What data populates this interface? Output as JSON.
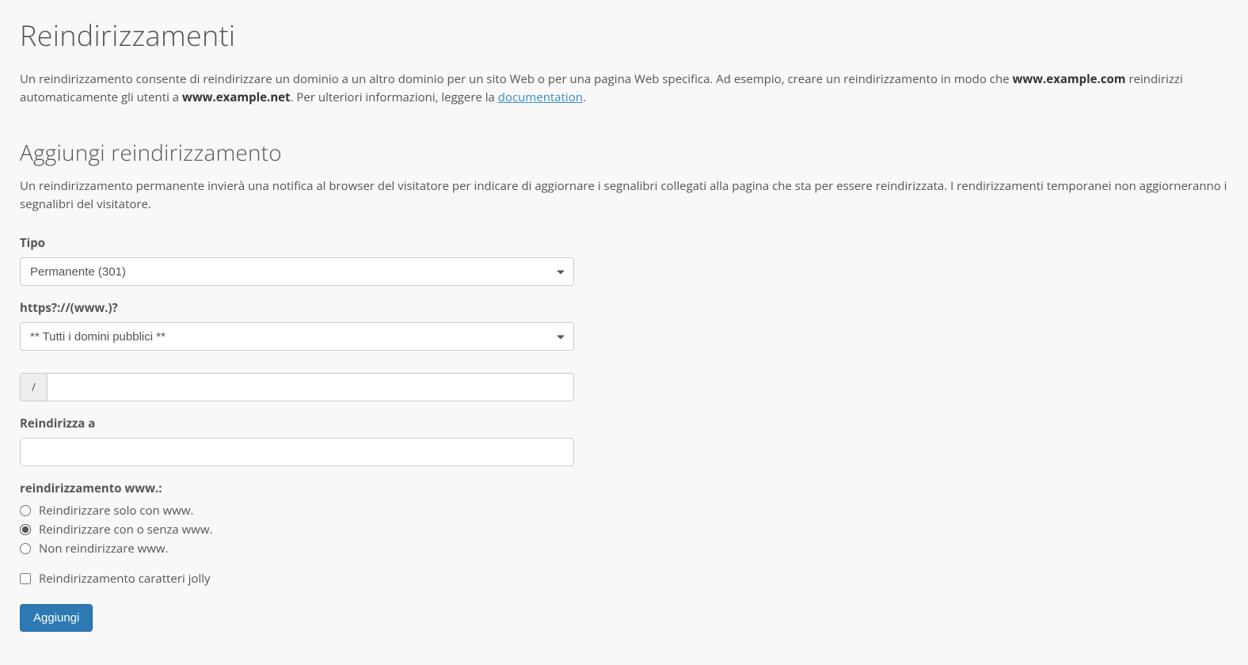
{
  "page": {
    "title": "Reindirizzamenti",
    "desc_part1": "Un reindirizzamento consente di reindirizzare un dominio a un altro dominio per un sito Web o per una pagina Web specifica. Ad esempio, creare un reindirizzamento in modo che ",
    "desc_bold1": "www.example.com",
    "desc_part2": " reindirizzi automaticamente gli utenti a ",
    "desc_bold2": "www.example.net",
    "desc_part3": ". Per ulteriori informazioni, leggere la ",
    "doc_link_text": "documentation",
    "desc_end": "."
  },
  "section": {
    "title": "Aggiungi reindirizzamento",
    "desc": "Un reindirizzamento permanente invierà una notifica al browser del visitatore per indicare di aggiornare i segnalibri collegati alla pagina che sta per essere reindirizzata. I rendirizzamenti temporanei non aggiorneranno i segnalibri del visitatore."
  },
  "form": {
    "type_label": "Tipo",
    "type_value": "Permanente (301)",
    "domain_label": "https?://(www.)?",
    "domain_value": "** Tutti i domini pubblici **",
    "path_prefix": "/",
    "path_value": "",
    "redirect_to_label": "Reindirizza a",
    "redirect_to_value": "",
    "www_label": "reindirizzamento www.:",
    "radio_options": [
      {
        "label": "Reindirizzare solo con www.",
        "checked": false
      },
      {
        "label": "Reindirizzare con o senza www.",
        "checked": true
      },
      {
        "label": "Non reindirizzare www.",
        "checked": false
      }
    ],
    "wildcard_label": "Reindirizzamento caratteri jolly",
    "wildcard_checked": false,
    "submit_label": "Aggiungi"
  }
}
